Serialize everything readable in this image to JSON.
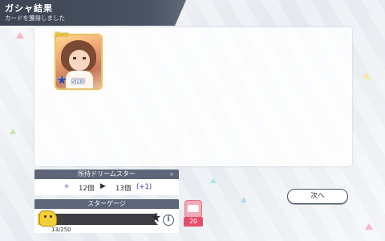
{
  "header": {
    "title": "ガシャ結果",
    "subtitle": "カードを獲得しました"
  },
  "card": {
    "badge": "New",
    "rarity": "SHS",
    "star_icon": "star-icon"
  },
  "dream_star": {
    "title": "所持ドリームスター",
    "close": "×",
    "before": "12個",
    "arrow": "▶",
    "after": "13個",
    "delta": "(+1)"
  },
  "star_gauge": {
    "title": "スターゲージ",
    "value_text": "13/250",
    "current": 13,
    "max": 250,
    "fill_fraction": 0.05
  },
  "ticket": {
    "count": "20"
  },
  "buttons": {
    "next_label": "次へ",
    "info_label": "i"
  },
  "colors": {
    "header_bg": "#3d4453",
    "section_title_bg": "#5d6678",
    "gauge_fill": "#f7c830",
    "ticket_badge": "#e54f6a",
    "delta_text": "#3a3ab8"
  }
}
